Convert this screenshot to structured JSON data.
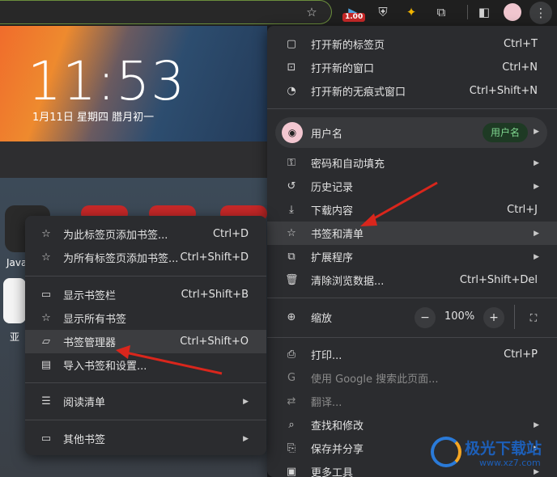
{
  "toolbar": {
    "icons": [
      "star-icon",
      "extension-badge-icon",
      "ublock-icon",
      "helper-icon",
      "puzzle-icon",
      "sidepanel-icon",
      "profile-avatar",
      "more-menu-icon"
    ],
    "badge": "1.00"
  },
  "background": {
    "clock": "11:53",
    "date": "1月11日  星期四  腊月初一",
    "apps": [
      "Java",
      "亚"
    ]
  },
  "main_menu": {
    "new_tab": {
      "label": "打开新的标签页",
      "shortcut": "Ctrl+T"
    },
    "new_window": {
      "label": "打开新的窗口",
      "shortcut": "Ctrl+N"
    },
    "incognito": {
      "label": "打开新的无痕式窗口",
      "shortcut": "Ctrl+Shift+N"
    },
    "profile": {
      "name": "用户名",
      "chip": "用户名"
    },
    "passwords": {
      "label": "密码和自动填充"
    },
    "history": {
      "label": "历史记录"
    },
    "downloads": {
      "label": "下载内容",
      "shortcut": "Ctrl+J"
    },
    "bookmarks": {
      "label": "书签和清单"
    },
    "extensions": {
      "label": "扩展程序"
    },
    "clear_data": {
      "label": "清除浏览数据...",
      "shortcut": "Ctrl+Shift+Del"
    },
    "zoom": {
      "label": "缩放",
      "minus": "−",
      "value": "100%",
      "plus": "+"
    },
    "print": {
      "label": "打印...",
      "shortcut": "Ctrl+P"
    },
    "google_search": {
      "label": "使用 Google 搜索此页面..."
    },
    "translate": {
      "label": "翻译..."
    },
    "find": {
      "label": "查找和修改"
    },
    "save_share": {
      "label": "保存并分享"
    },
    "more_tools": {
      "label": "更多工具"
    }
  },
  "sub_menu": {
    "bookmark_tab": {
      "label": "为此标签页添加书签...",
      "shortcut": "Ctrl+D"
    },
    "bookmark_all": {
      "label": "为所有标签页添加书签...",
      "shortcut": "Ctrl+Shift+D"
    },
    "show_bar": {
      "label": "显示书签栏",
      "shortcut": "Ctrl+Shift+B"
    },
    "show_all": {
      "label": "显示所有书签"
    },
    "manager": {
      "label": "书签管理器",
      "shortcut": "Ctrl+Shift+O"
    },
    "import": {
      "label": "导入书签和设置..."
    },
    "reading_list": {
      "label": "阅读清单"
    },
    "other": {
      "label": "其他书签"
    }
  },
  "watermark": {
    "title": "极光下载站",
    "url": "www.xz7.com"
  },
  "colors": {
    "menu_bg": "#2b2c2f",
    "highlight": "#3c3d40",
    "accent_green": "#7fd68f",
    "arrow_red": "#d9261c"
  }
}
